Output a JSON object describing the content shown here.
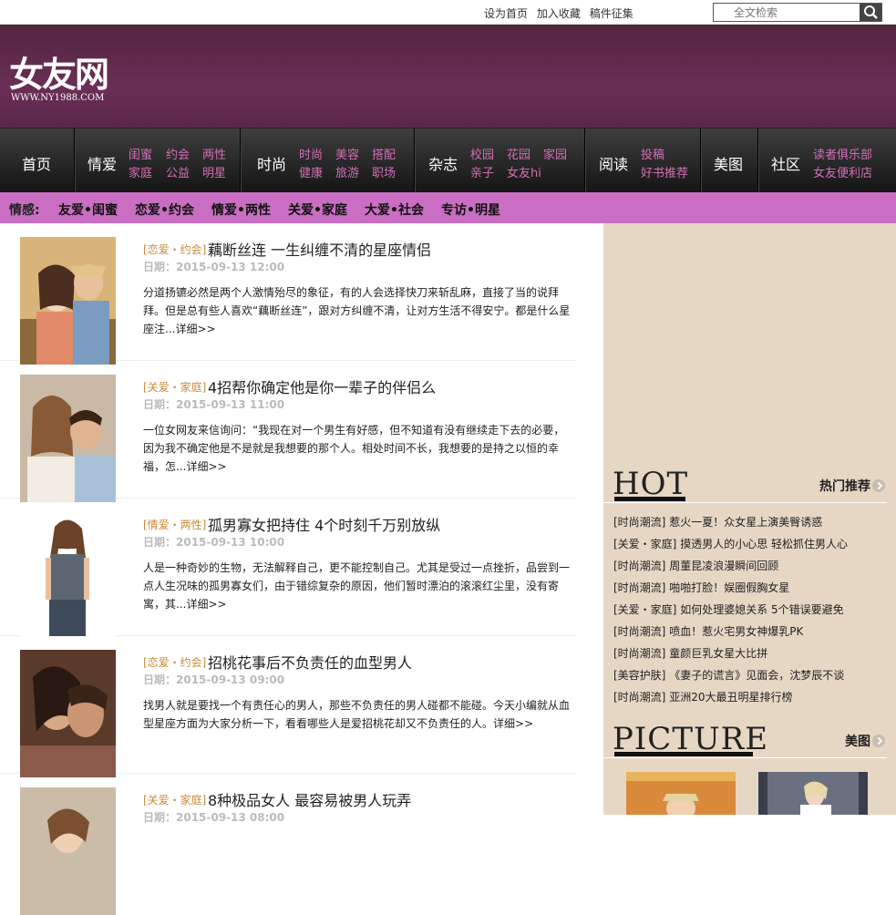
{
  "topbar": {
    "links": [
      "设为首页",
      "加入收藏",
      "稿件征集"
    ],
    "search_placeholder": "全文检索"
  },
  "logo": {
    "mark": "女友网",
    "url": "WWW.NY1988.COM"
  },
  "nav": [
    {
      "label": "首页",
      "subs": []
    },
    {
      "label": "情爱",
      "subs": [
        "闺蜜",
        "约会",
        "两性",
        "家庭",
        "公益",
        "明星"
      ]
    },
    {
      "label": "时尚",
      "subs": [
        "时尚",
        "美容",
        "搭配",
        "健康",
        "旅游",
        "职场"
      ]
    },
    {
      "label": "杂志",
      "subs": [
        "校园",
        "花园",
        "家园",
        "亲子",
        "女友hi"
      ]
    },
    {
      "label": "阅读",
      "subs": [
        "投稿",
        "好书推荐"
      ]
    },
    {
      "label": "美图",
      "subs": []
    },
    {
      "label": "社区",
      "subs": [
        "读者俱乐部",
        "女友便利店"
      ]
    }
  ],
  "subnav": {
    "lead": "情感:",
    "items": [
      "友爱•闺蜜",
      "恋爱•约会",
      "情爱•两性",
      "关爱•家庭",
      "大爱•社会",
      "专访•明星"
    ]
  },
  "articles": [
    {
      "tag": "[恋爱・约会]",
      "title": "藕断丝连 一生纠缠不清的星座情侣",
      "date": "日期：2015-09-13 12:00",
      "summary": "分道扬镳必然是两个人激情殆尽的象征，有的人会选择快刀来斩乱麻，直接了当的说拜拜。但是总有些人喜欢“藕断丝连”，跟对方纠缠不清，让对方生活不得安宁。都是什么星座注...",
      "more": "详细>>"
    },
    {
      "tag": "[关爱・家庭]",
      "title": "4招帮你确定他是你一辈子的伴侣么",
      "date": "日期：2015-09-13 11:00",
      "summary": "一位女网友来信询问：“我现在对一个男生有好感，但不知道有没有继续走下去的必要，因为我不确定他是不是就是我想要的那个人。相处时间不长，我想要的是持之以恒的幸福，怎...",
      "more": "详细>>"
    },
    {
      "tag": "[情爱・两性]",
      "title": "孤男寡女把持住 4个时刻千万别放纵",
      "date": "日期：2015-09-13 10:00",
      "summary": "人是一种奇妙的生物，无法解释自己，更不能控制自己。尤其是受过一点挫折，品尝到一点人生况味的孤男寡女们，由于错综复杂的原因，他们暂时漂泊的滚滚红尘里，没有寄寓，其...",
      "more": "详细>>"
    },
    {
      "tag": "[恋爱・约会]",
      "title": "招桃花事后不负责任的血型男人",
      "date": "日期：2015-09-13 09:00",
      "summary": "找男人就是要找一个有责任心的男人，那些不负责任的男人碰都不能碰。今天小编就从血型星座方面为大家分析一下，看看哪些人是爱招桃花却又不负责任的人。",
      "more": "详细>>"
    },
    {
      "tag": "[关爱・家庭]",
      "title": "8种极品女人 最容易被男人玩弄",
      "date": "日期：2015-09-13 08:00",
      "summary": "",
      "more": ""
    }
  ],
  "hot": {
    "heading": "HOT",
    "more": "热门推荐",
    "items": [
      {
        "tag": "[时尚潮流]",
        "text": "惹火一夏！众女星上演美臀诱惑"
      },
      {
        "tag": "[关爱・家庭]",
        "text": "摸透男人的小心思 轻松抓住男人心"
      },
      {
        "tag": "[时尚潮流]",
        "text": "周董昆凌浪漫瞬间回顾"
      },
      {
        "tag": "[时尚潮流]",
        "text": "啪啪打脸！娱圈假胸女星"
      },
      {
        "tag": "[关爱・家庭]",
        "text": "如何处理婆媳关系 5个错误要避免"
      },
      {
        "tag": "[时尚潮流]",
        "text": "喷血！惹火宅男女神爆乳PK"
      },
      {
        "tag": "[时尚潮流]",
        "text": "童颜巨乳女星大比拼"
      },
      {
        "tag": "[美容护肤]",
        "text": "《妻子的谎言》见面会，沈梦辰不谈"
      },
      {
        "tag": "[时尚潮流]",
        "text": "亚洲20大最丑明星排行榜"
      }
    ]
  },
  "picture": {
    "heading": "PICTURE",
    "more": "美图"
  },
  "colors": {
    "header": "#5a2749",
    "accent": "#c96ec2",
    "nav_sub": "#d46fb6",
    "sidebar": "#e6d7c5",
    "tag": "#c88a3b"
  }
}
